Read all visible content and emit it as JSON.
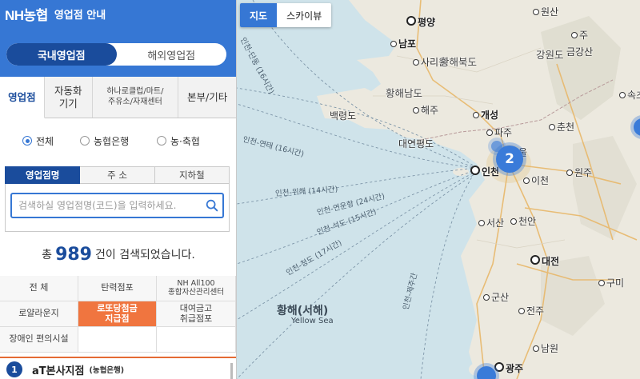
{
  "header": {
    "brand": "NH농협",
    "title": "영업점 안내"
  },
  "region_toggle": {
    "domestic": "국내영업점",
    "overseas": "해외영업점"
  },
  "category_tabs": [
    {
      "label": "영업점"
    },
    {
      "label": "자동화\n기기"
    },
    {
      "label": "하나로클럽/마트/\n주유소/자재센터"
    },
    {
      "label": "본부/기타"
    }
  ],
  "bank_filter": [
    {
      "label": "전체",
      "selected": true
    },
    {
      "label": "농협은행",
      "selected": false
    },
    {
      "label": "농·축협",
      "selected": false
    }
  ],
  "search": {
    "tabs": [
      "영업점명",
      "주 소",
      "지하철"
    ],
    "placeholder": "검색하실 영업점명(코드)을 입력하세요."
  },
  "result": {
    "prefix": "총",
    "count": "989",
    "suffix": "건이 검색되었습니다."
  },
  "service_grid": [
    [
      "전 체",
      "탄력점포",
      "NH All100\n종합자산관리센터"
    ],
    [
      "로얄라운지",
      "로또당첨금\n지급점",
      "대여금고\n취급점포"
    ],
    [
      "장애인 편의시설",
      "",
      ""
    ]
  ],
  "service_active": "로또당첨금\n지급점",
  "list": [
    {
      "num": "1",
      "name": "aT본사지점",
      "type": "(농협은행)"
    }
  ],
  "map": {
    "type_buttons": {
      "map": "지도",
      "sky": "스카이뷰"
    },
    "labels": {
      "pyongyang": "평양",
      "nampo": "남포",
      "sariwon": "사리원",
      "hwanghae_n": "황해북도",
      "hwanghae_s": "황해남도",
      "haeju": "해주",
      "kaesong": "개성",
      "paju": "파주",
      "yeonpyeong": "대연평도",
      "baengnyeong": "백령도",
      "incheon": "인천",
      "icheon": "이천",
      "wonju": "원주",
      "chuncheon": "춘천",
      "wonsan": "원산",
      "gangwon": "강원도",
      "geumgang": "금강산",
      "sokcho": "속초",
      "seosan": "서산",
      "cheonan": "천안",
      "daejeon": "대전",
      "gumi": "구미",
      "gunsan": "군산",
      "jeonju": "전주",
      "namwon": "남원",
      "gwangju": "광주",
      "ui": "울",
      "ju": "주"
    },
    "sea": {
      "ko": "황해(서해)",
      "en": "Yellow Sea"
    },
    "routes": [
      "인천-단동 (16시간)",
      "인천-연태 (16시간)",
      "인천-위해 (14시간)",
      "인천-연운항 (24시간)",
      "인천-석도 (15시간)",
      "인천-청도 (17시간)",
      "인천-제주간"
    ],
    "clusters": [
      "2"
    ]
  },
  "colors": {
    "primary": "#3677d4",
    "navy": "#1a4c9c",
    "accent": "#f0753f",
    "sea": "#cfe3ea",
    "land": "#ece9df"
  }
}
